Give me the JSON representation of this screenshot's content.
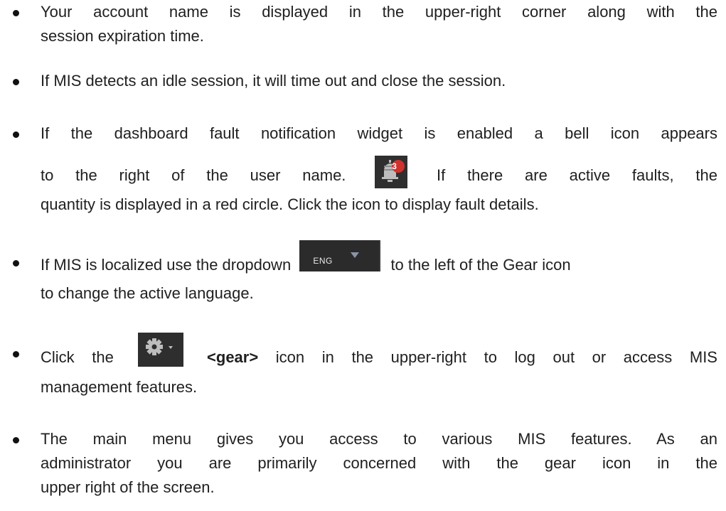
{
  "bullets": [
    {
      "lines": [
        "Your account name is displayed in the upper-right corner along with the",
        "session expiration time."
      ]
    },
    {
      "lines": [
        "If MIS detects an idle session, it will time out and close the session."
      ]
    },
    {
      "line1": "If the dashboard fault notification widget is enabled a bell icon appears",
      "line2_before": "to the right of the user name.",
      "line2_after": "If there are active faults, the",
      "line3": "quantity is displayed in a red circle. Click the icon to display fault details."
    },
    {
      "before": "If MIS is localized use the dropdown",
      "after": "to the left of the Gear icon",
      "line2": "to change the active language."
    },
    {
      "before": "Click the",
      "bold": "<gear>",
      "after": "icon in the upper-right to log out or access MIS",
      "line2": "management features."
    },
    {
      "lines": [
        "The main menu gives you access to various MIS features. As an",
        "administrator you are primarily concerned with the gear icon in the",
        "upper right of the screen."
      ]
    }
  ],
  "icons": {
    "bell": {
      "name": "bell-icon",
      "badge_count": "3",
      "badge_color": "#d0312d"
    },
    "language": {
      "name": "language-dropdown",
      "code": "ENG",
      "caret": "chevron-down-icon"
    },
    "gear": {
      "name": "gear-icon",
      "caret": "chevron-down-icon"
    }
  },
  "colors": {
    "text": "#1f1f1f",
    "icon_background": "#2e2e2e",
    "badge": "#d0312d"
  }
}
